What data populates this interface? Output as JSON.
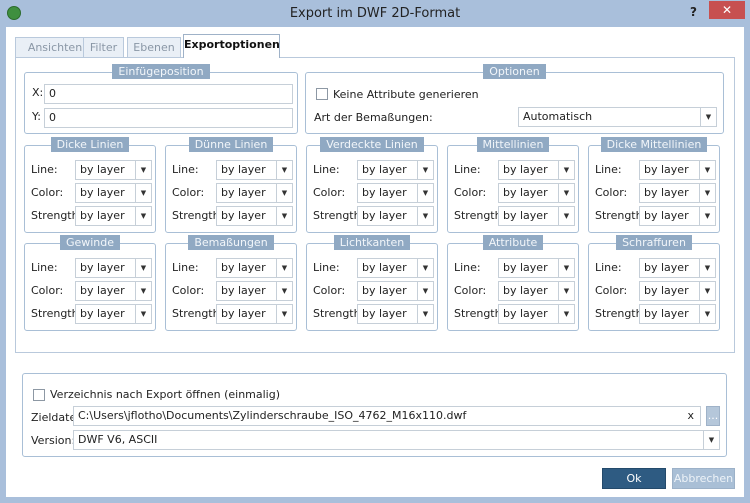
{
  "window": {
    "title": "Export im DWF 2D-Format",
    "help": "?",
    "close": "✕"
  },
  "tabs": [
    {
      "label": "Ansichten"
    },
    {
      "label": "Filter"
    },
    {
      "label": "Ebenen"
    },
    {
      "label": "Exportoptionen"
    }
  ],
  "insert": {
    "title": "Einfügeposition",
    "x_label": "X:",
    "x_value": "0",
    "y_label": "Y:",
    "y_value": "0"
  },
  "options": {
    "title": "Optionen",
    "no_attr_label": "Keine Attribute generieren",
    "no_attr_checked": false,
    "dim_label": "Art der Bemaßungen:",
    "dim_value": "Automatisch"
  },
  "row_labels": {
    "line": "Line:",
    "color": "Color:",
    "strength": "Strength:"
  },
  "line_groups": [
    {
      "title": "Dicke Linien",
      "line": "by layer",
      "color": "by layer",
      "strength": "by layer"
    },
    {
      "title": "Dünne Linien",
      "line": "by layer",
      "color": "by layer",
      "strength": "by layer"
    },
    {
      "title": "Verdeckte Linien",
      "line": "by layer",
      "color": "by layer",
      "strength": "by layer"
    },
    {
      "title": "Mittellinien",
      "line": "by layer",
      "color": "by layer",
      "strength": "by layer"
    },
    {
      "title": "Dicke Mittellinien",
      "line": "by layer",
      "color": "by layer",
      "strength": "by layer"
    },
    {
      "title": "Gewinde",
      "line": "by layer",
      "color": "by layer",
      "strength": "by layer"
    },
    {
      "title": "Bemaßungen",
      "line": "by layer",
      "color": "by layer",
      "strength": "by layer"
    },
    {
      "title": "Lichtkanten",
      "line": "by layer",
      "color": "by layer",
      "strength": "by layer"
    },
    {
      "title": "Attribute",
      "line": "by layer",
      "color": "by layer",
      "strength": "by layer"
    },
    {
      "title": "Schraffuren",
      "line": "by layer",
      "color": "by layer",
      "strength": "by layer"
    }
  ],
  "output": {
    "open_dir_label": "Verzeichnis nach Export öffnen (einmalig)",
    "open_dir_checked": false,
    "target_label": "Zieldatei:",
    "target_value": "C:\\Users\\jflotho\\Documents\\Zylinderschraube_ISO_4762_M16x110.dwf",
    "clear": "x",
    "browse": "...",
    "version_label": "Version:",
    "version_value": "DWF V6, ASCII"
  },
  "buttons": {
    "ok": "Ok",
    "cancel": "Abbrechen"
  }
}
